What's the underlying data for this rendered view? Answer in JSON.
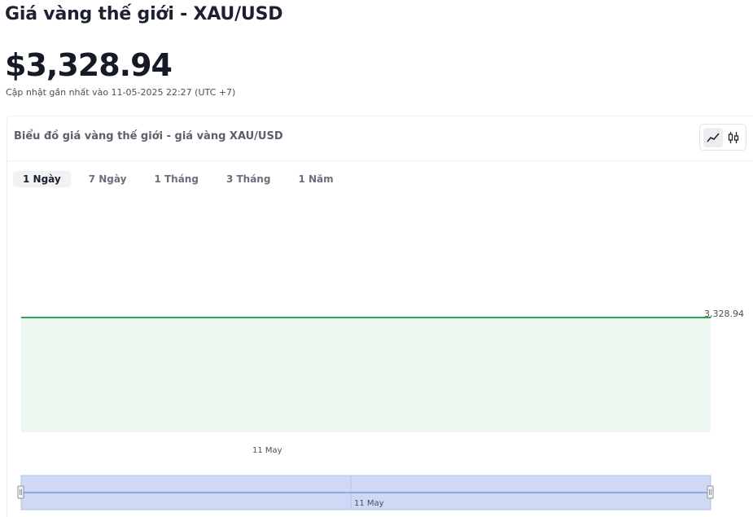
{
  "header": {
    "title": "Giá vàng thế giới - XAU/USD",
    "price": "$3,328.94",
    "updated": "Cập nhật gần nhất vào 11-05-2025 22:27 (UTC +7)"
  },
  "chart_card": {
    "title": "Biểu đồ giá vàng thế giới - giá vàng XAU/USD",
    "view_toggle": [
      "line-chart-icon",
      "candlestick-chart-icon"
    ],
    "active_view": "line-chart-icon"
  },
  "tabs": [
    {
      "label": "1 Ngày",
      "active": true
    },
    {
      "label": "7 Ngày",
      "active": false
    },
    {
      "label": "1 Tháng",
      "active": false
    },
    {
      "label": "3 Tháng",
      "active": false
    },
    {
      "label": "1 Năm",
      "active": false
    }
  ],
  "colors": {
    "line": "#2fa35a",
    "area": "#eef8f1",
    "navigator_fill": "#cfd9f6",
    "navigator_line": "#6b8ed6"
  },
  "chart_data": {
    "type": "area",
    "x": [
      "11 May"
    ],
    "series": [
      {
        "values": [
          3328.94
        ]
      }
    ],
    "last_value_label": "3,328.94",
    "navigator_label": "11 May"
  }
}
